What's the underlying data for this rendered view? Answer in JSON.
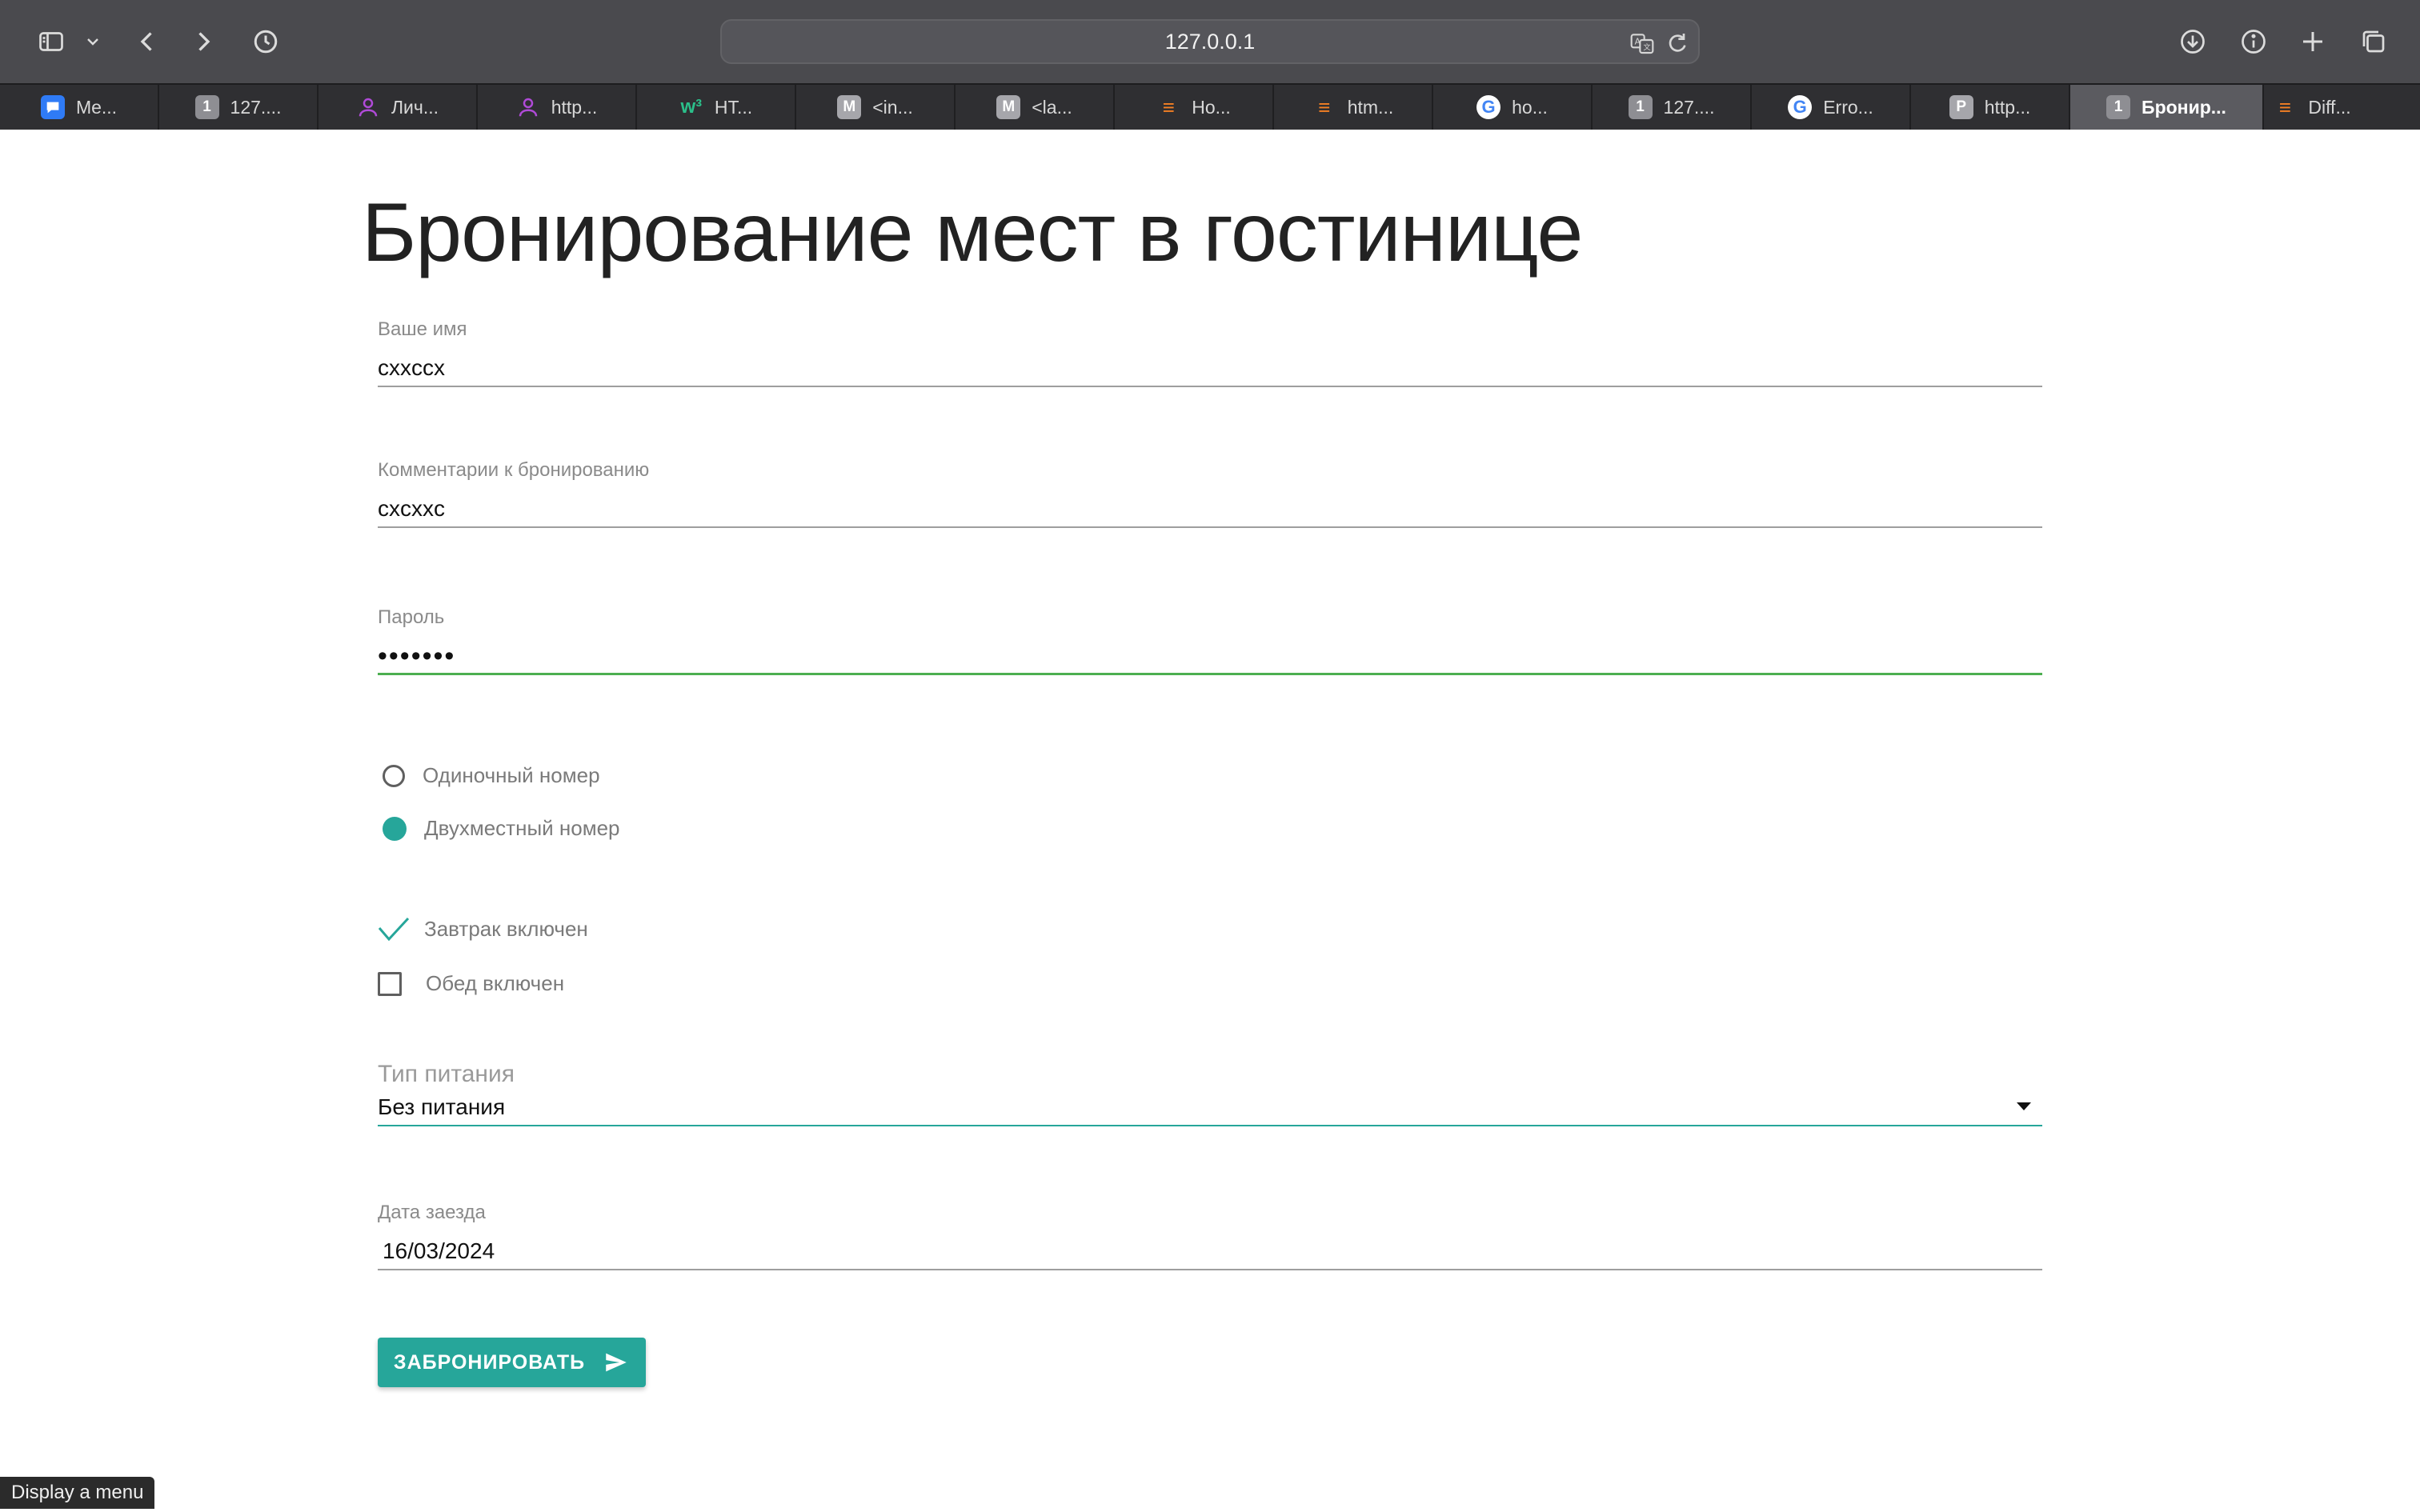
{
  "browser": {
    "url": "127.0.0.1",
    "tabs": [
      {
        "label": "Me...",
        "favicon": "chat-icon"
      },
      {
        "label": "127....",
        "favicon": "1"
      },
      {
        "label": "Лич...",
        "favicon": "user-icon"
      },
      {
        "label": "http...",
        "favicon": "user-icon"
      },
      {
        "label": "HT...",
        "favicon": "w3"
      },
      {
        "label": "<in...",
        "favicon": "M"
      },
      {
        "label": "<la...",
        "favicon": "M"
      },
      {
        "label": "Ho...",
        "favicon": "stackoverflow-icon"
      },
      {
        "label": "htm...",
        "favicon": "stackoverflow-icon"
      },
      {
        "label": "ho...",
        "favicon": "G"
      },
      {
        "label": "127....",
        "favicon": "1"
      },
      {
        "label": "Erro...",
        "favicon": "G"
      },
      {
        "label": "http...",
        "favicon": "P"
      },
      {
        "label": "Бронир...",
        "favicon": "1"
      },
      {
        "label": "Diff...",
        "favicon": "stackoverflow-icon"
      }
    ],
    "active_tab_index": 13
  },
  "page": {
    "title": "Бронирование мест в гостинице",
    "name_field": {
      "label": "Ваше имя",
      "value": "cxxccx"
    },
    "comment_field": {
      "label": "Комментарии к бронированию",
      "value": "cxcxxc"
    },
    "password_field": {
      "label": "Пароль",
      "value": "•••••••"
    },
    "room_options": [
      {
        "label": "Одиночный номер",
        "selected": false
      },
      {
        "label": "Двухместный номер",
        "selected": true
      }
    ],
    "meal_checks": [
      {
        "label": "Завтрак включен",
        "checked": true
      },
      {
        "label": "Обед включен",
        "checked": false
      }
    ],
    "food_select": {
      "label": "Тип питания",
      "value": "Без питания"
    },
    "date_field": {
      "label": "Дата заезда",
      "value": "16/03/2024"
    },
    "submit_label": "ЗАБРОНИРОВАТЬ"
  },
  "status_tooltip": "Display a menu",
  "colors": {
    "accent": "#26a69a",
    "focus_green": "#4caf50",
    "toolbar_bg": "#4a4a4e",
    "tabbar_bg": "#2f2f32"
  }
}
